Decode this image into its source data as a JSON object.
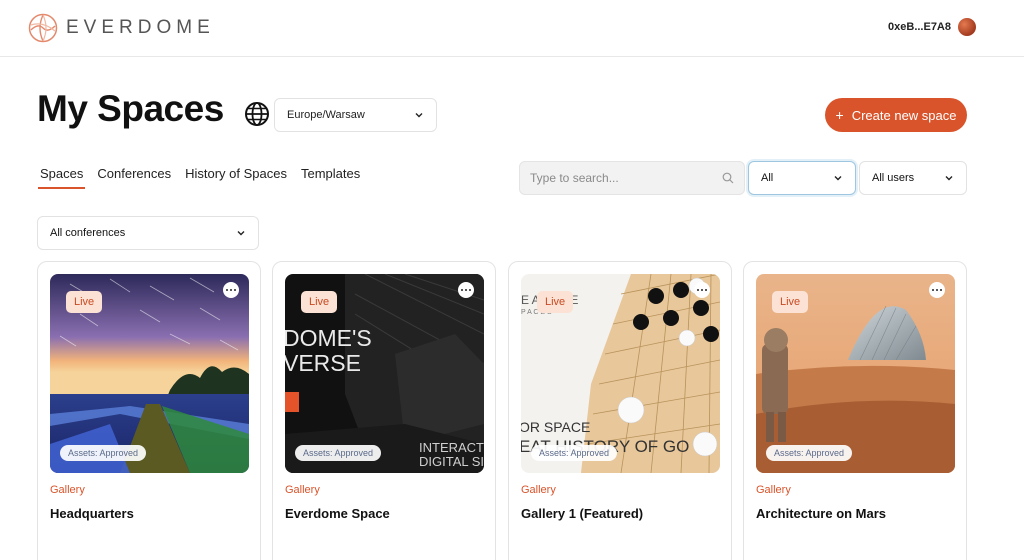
{
  "brand": {
    "name": "EVERDOME"
  },
  "wallet": {
    "address": "0xeB...E7A8"
  },
  "page": {
    "title": "My Spaces"
  },
  "timezone": {
    "selected": "Europe/Warsaw"
  },
  "create_button": {
    "label": "Create new space",
    "icon": "+"
  },
  "tabs": [
    {
      "label": "Spaces",
      "active": true
    },
    {
      "label": "Conferences",
      "active": false
    },
    {
      "label": "History of Spaces",
      "active": false
    },
    {
      "label": "Templates",
      "active": false
    }
  ],
  "search": {
    "placeholder": "Type to search...",
    "value": ""
  },
  "filters": {
    "type_selected": "All",
    "users_selected": "All users"
  },
  "conference_filter": {
    "selected": "All conferences"
  },
  "cards": [
    {
      "status": "Live",
      "assets_badge": "Assets: Approved",
      "category": "Gallery",
      "title": "Headquarters",
      "image_text": []
    },
    {
      "status": "Live",
      "assets_badge": "Assets: Approved",
      "category": "Gallery",
      "title": "Everdome Space",
      "image_text": [
        "DOME'S",
        "VERSE",
        "INTERACT",
        "DIGITAL SI"
      ]
    },
    {
      "status": "Live",
      "assets_badge": "Assets: Approved",
      "category": "Gallery",
      "title": "Gallery 1 (Featured)",
      "image_text": [
        "OR SPACE",
        "EAT HISTORY OF GO",
        "E AND ME",
        "P A C E S"
      ]
    },
    {
      "status": "Live",
      "assets_badge": "Assets: Approved",
      "category": "Gallery",
      "title": "Architecture on Mars",
      "image_text": []
    }
  ],
  "colors": {
    "accent": "#d9542b",
    "live_bg": "#fbe2d4"
  }
}
